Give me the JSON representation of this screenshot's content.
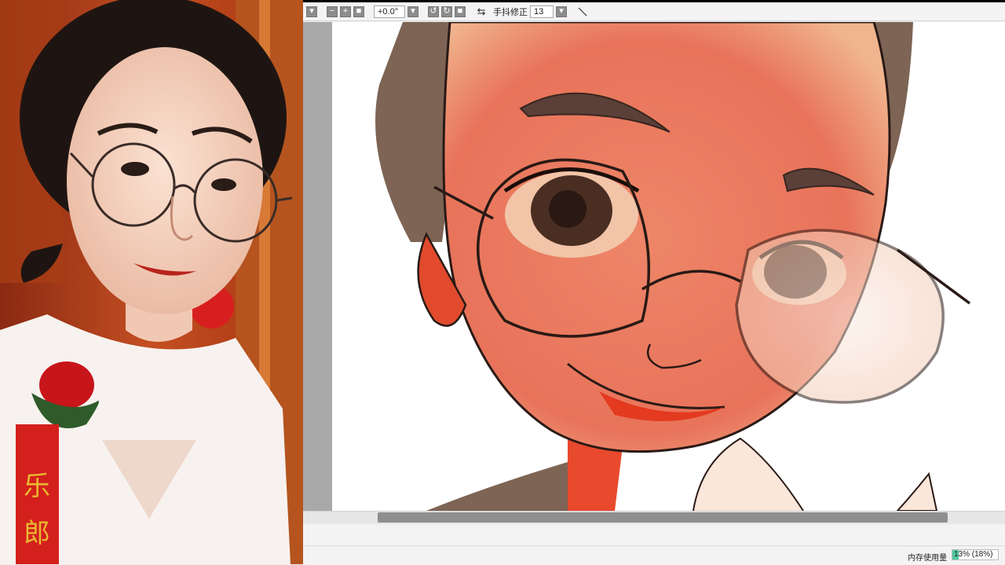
{
  "toolbar": {
    "zoom_out_icon": "minus-icon",
    "zoom_in_icon": "plus-icon",
    "rotation_value": "+0.0°",
    "flip_icon": "flip-horizontal-icon",
    "stabilizer_label": "手抖修正",
    "stabilizer_value": "13",
    "pen_icon": "diagonal-line-icon"
  },
  "status": {
    "memory_label": "内存使用量",
    "memory_value": "13% (18%)",
    "memory_fraction": 0.13
  },
  "colors": {
    "skin": "#e8735a",
    "hair": "#7d6454",
    "lineart": "#2a1a16",
    "memory_fill": "#4fc9a0"
  }
}
